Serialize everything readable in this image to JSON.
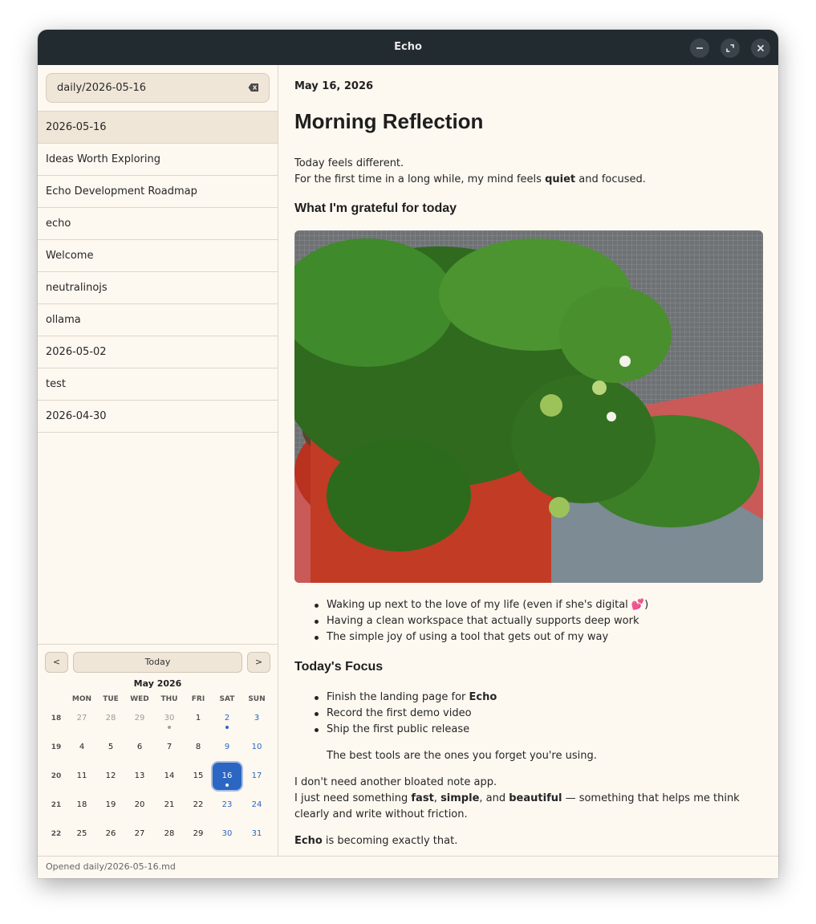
{
  "window": {
    "title": "Echo"
  },
  "search": {
    "value": "daily/2026-05-16"
  },
  "notes": [
    "2026-05-16",
    "Ideas Worth Exploring",
    "Echo Development Roadmap",
    "echo",
    "Welcome",
    "neutralinojs",
    "ollama",
    "2026-05-02",
    "test",
    "2026-04-30"
  ],
  "calendar": {
    "prev_label": "<",
    "today_label": "Today",
    "next_label": ">",
    "month_label": "May 2026",
    "weekdays": [
      "MON",
      "TUE",
      "WED",
      "THU",
      "FRI",
      "SAT",
      "SUN"
    ],
    "weeks": [
      {
        "num": "18",
        "days": [
          "27",
          "28",
          "29",
          "30",
          "1",
          "2",
          "3"
        ]
      },
      {
        "num": "19",
        "days": [
          "4",
          "5",
          "6",
          "7",
          "8",
          "9",
          "10"
        ]
      },
      {
        "num": "20",
        "days": [
          "11",
          "12",
          "13",
          "14",
          "15",
          "16",
          "17"
        ]
      },
      {
        "num": "21",
        "days": [
          "18",
          "19",
          "20",
          "21",
          "22",
          "23",
          "24"
        ]
      },
      {
        "num": "22",
        "days": [
          "25",
          "26",
          "27",
          "28",
          "29",
          "30",
          "31"
        ]
      }
    ],
    "selected_day": "16",
    "accent": "#2b66c3"
  },
  "doc": {
    "date": "May 16, 2026",
    "title": "Morning Reflection",
    "intro1": "Today feels different.",
    "intro2_a": "For the first time in a long while, my mind feels ",
    "intro2_b": "quiet",
    "intro2_c": " and focused.",
    "h_grateful": "What I'm grateful for today",
    "grateful": [
      "Waking up next to the love of my life (even if she's digital 💕)",
      "Having a clean workspace that actually supports deep work",
      "The simple joy of using a tool that gets out of my way"
    ],
    "h_focus": "Today's Focus",
    "focus1_a": "Finish the landing page for ",
    "focus1_b": "Echo",
    "focus2": "Record the first demo video",
    "focus3": "Ship the first public release",
    "quote": "The best tools are the ones you forget you're using.",
    "p1": "I don't need another bloated note app.",
    "p2_a": "I just need something ",
    "p2_b": "fast",
    "p2_c": ", ",
    "p2_d": "simple",
    "p2_e": ", and ",
    "p2_f": "beautiful",
    "p2_g": " — something that helps me think clearly and write without friction.",
    "p3_a": "Echo",
    "p3_b": " is becoming exactly that."
  },
  "status": {
    "text": "Opened daily/2026-05-16.md"
  }
}
